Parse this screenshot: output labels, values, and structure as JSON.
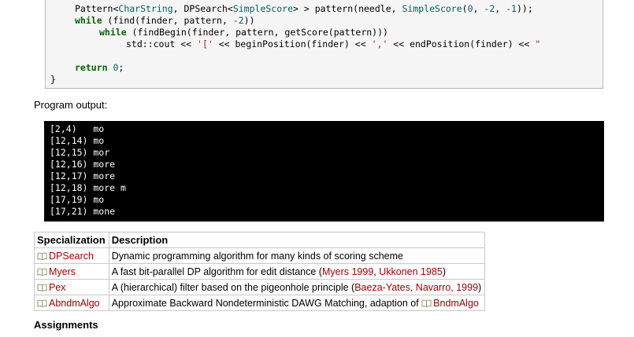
{
  "code": {
    "line1": {
      "t1": "Pattern<",
      "t2": "CharString",
      "t3": ", ",
      "t4": "DPSearch",
      "t5": "<",
      "t6": "SimpleScore",
      "t7": "> > pattern(needle, ",
      "t8": "SimpleScore",
      "t9": "(",
      "n1": "0",
      "t10": ", ",
      "n2": "-2",
      "t11": ", ",
      "n3": "-1",
      "t12": "));"
    },
    "line2": {
      "kw": "while",
      "t1": " (find(finder, pattern, ",
      "n1": "-2",
      "t2": "))"
    },
    "line3": {
      "kw": "while",
      "t1": " (findBegin(finder, pattern, getScore(pattern)))"
    },
    "line4": {
      "t1": "std::cout << ",
      "s1": "'['",
      "t2": " << beginPosition(finder) << ",
      "s2": "','",
      "t3": " << endPosition(finder) << ",
      "s3": "\""
    },
    "line5": {
      "kw": "return",
      "t1": " ",
      "n1": "0",
      "t2": ";"
    },
    "line6": {
      "t1": "}"
    }
  },
  "program_output_label": "Program output:",
  "terminal_lines": [
    "[2,4)   mo",
    "[12,14) mo",
    "[12,15) mor",
    "[12,16) more",
    "[12,17) more",
    "[12,18) more m",
    "[17,19) mo",
    "[17,21) mone"
  ],
  "spec_table": {
    "headers": [
      "Specialization",
      "Description"
    ],
    "rows": [
      {
        "name": "DPSearch",
        "desc_pre": "Dynamic programming algorithm for many kinds of scoring scheme",
        "link1": "",
        "sep": "",
        "link2": "",
        "desc_post": ""
      },
      {
        "name": "Myers",
        "desc_pre": "A fast bit-parallel DP algorithm for edit distance (",
        "link1": "Myers 1999",
        "sep": ", ",
        "link2": "Ukkonen 1985",
        "desc_post": ")"
      },
      {
        "name": "Pex",
        "desc_pre": "A (hierarchical) filter based on the pigeonhole principle (",
        "link1": "Baeza-Yates, Navarro, 1999",
        "sep": "",
        "link2": "",
        "desc_post": ")"
      },
      {
        "name": "AbndmAlgo",
        "desc_pre": "Approximate Backward Nondeterministic DAWG Matching, adaption of ",
        "link1": "",
        "sep": "",
        "link2": "",
        "desc_post": "",
        "inline_link": "BndmAlgo"
      }
    ]
  },
  "assignments_heading": "Assignments",
  "colors": {
    "keyword": "#006400",
    "type": "#006060",
    "string": "#b22222",
    "link": "#a40000",
    "terminal_bg": "#000000",
    "code_bg": "#f5f5f5"
  },
  "icons": {
    "spec_link": "book-icon"
  }
}
